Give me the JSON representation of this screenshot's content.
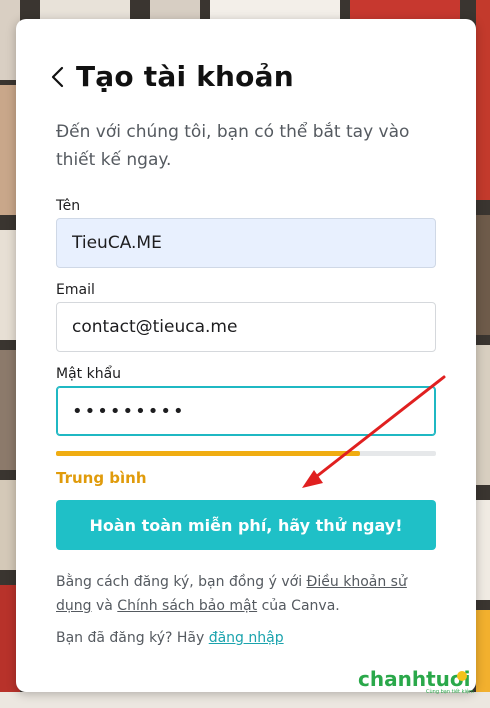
{
  "header": {
    "back_icon": "chevron-left-icon",
    "title": "Tạo tài khoản",
    "subtitle": "Đến với chúng tôi, bạn có thể bắt tay vào thiết kế ngay."
  },
  "form": {
    "name": {
      "label": "Tên",
      "value": "TieuCA.ME"
    },
    "email": {
      "label": "Email",
      "value": "contact@tieuca.me"
    },
    "password": {
      "label": "Mật khẩu",
      "value": "•••••••••"
    },
    "strength": {
      "label": "Trung bình",
      "level_fraction": 0.8
    },
    "submit_label": "Hoàn toàn miễn phí, hãy thử ngay!"
  },
  "terms": {
    "prefix": "Bằng cách đăng ký, bạn đồng ý với ",
    "terms_link": "Điều khoản sử dụng",
    "middle": " và ",
    "privacy_link": "Chính sách bảo mật",
    "suffix": " của Canva."
  },
  "login": {
    "prefix": "Bạn đã đăng ký? Hãy ",
    "link": "đăng nhập"
  },
  "colors": {
    "accent": "#1fc0c7",
    "focus_border": "#1fb8c3",
    "strength": "#f0ad12",
    "arrow": "#e02020"
  },
  "watermark": {
    "brand": "chanhtuoi",
    "tagline": "Cùng bạn tiết kiệm"
  }
}
